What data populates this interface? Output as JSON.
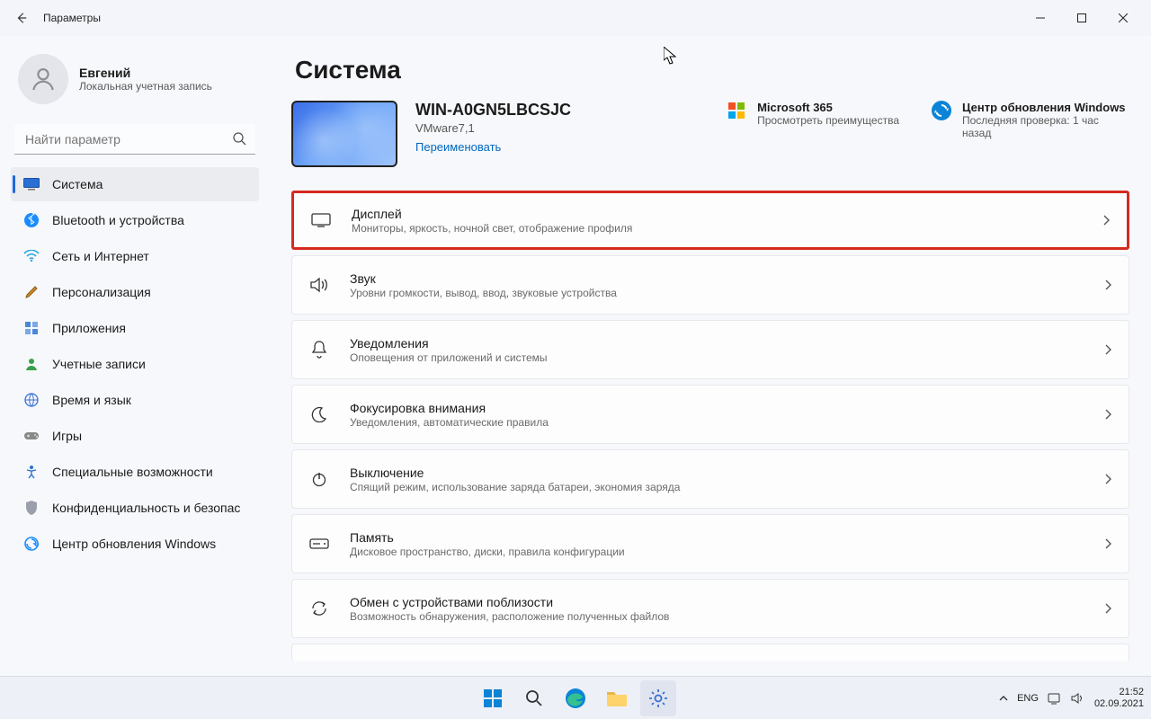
{
  "window": {
    "title": "Параметры"
  },
  "user": {
    "name": "Евгений",
    "subtitle": "Локальная учетная запись"
  },
  "search": {
    "placeholder": "Найти параметр"
  },
  "nav": [
    {
      "label": "Система",
      "icon": "💻"
    },
    {
      "label": "Bluetooth и устройства",
      "icon": "bt"
    },
    {
      "label": "Сеть и Интернет",
      "icon": "🔵"
    },
    {
      "label": "Персонализация",
      "icon": "brush"
    },
    {
      "label": "Приложения",
      "icon": "apps"
    },
    {
      "label": "Учетные записи",
      "icon": "👤"
    },
    {
      "label": "Время и язык",
      "icon": "🌐"
    },
    {
      "label": "Игры",
      "icon": "🎮"
    },
    {
      "label": "Специальные возможности",
      "icon": "acc"
    },
    {
      "label": "Конфиденциальность и безопас",
      "icon": "🛡"
    },
    {
      "label": "Центр обновления Windows",
      "icon": "🔄"
    }
  ],
  "page": {
    "title": "Система"
  },
  "device": {
    "name": "WIN-A0GN5LBCSJC",
    "model": "VMware7,1",
    "rename": "Переименовать"
  },
  "tiles": {
    "m365": {
      "title": "Microsoft 365",
      "sub": "Просмотреть преимущества"
    },
    "update": {
      "title": "Центр обновления Windows",
      "sub": "Последняя проверка: 1 час назад"
    }
  },
  "rows": [
    {
      "title": "Дисплей",
      "sub": "Мониторы, яркость, ночной свет, отображение профиля"
    },
    {
      "title": "Звук",
      "sub": "Уровни громкости, вывод, ввод, звуковые устройства"
    },
    {
      "title": "Уведомления",
      "sub": "Оповещения от приложений и системы"
    },
    {
      "title": "Фокусировка внимания",
      "sub": "Уведомления, автоматические правила"
    },
    {
      "title": "Выключение",
      "sub": "Спящий режим, использование заряда батареи, экономия заряда"
    },
    {
      "title": "Память",
      "sub": "Дисковое пространство, диски, правила конфигурации"
    },
    {
      "title": "Обмен с устройствами поблизости",
      "sub": "Возможность обнаружения, расположение полученных файлов"
    }
  ],
  "taskbar": {
    "lang": "ENG",
    "time": "21:52",
    "date": "02.09.2021"
  }
}
